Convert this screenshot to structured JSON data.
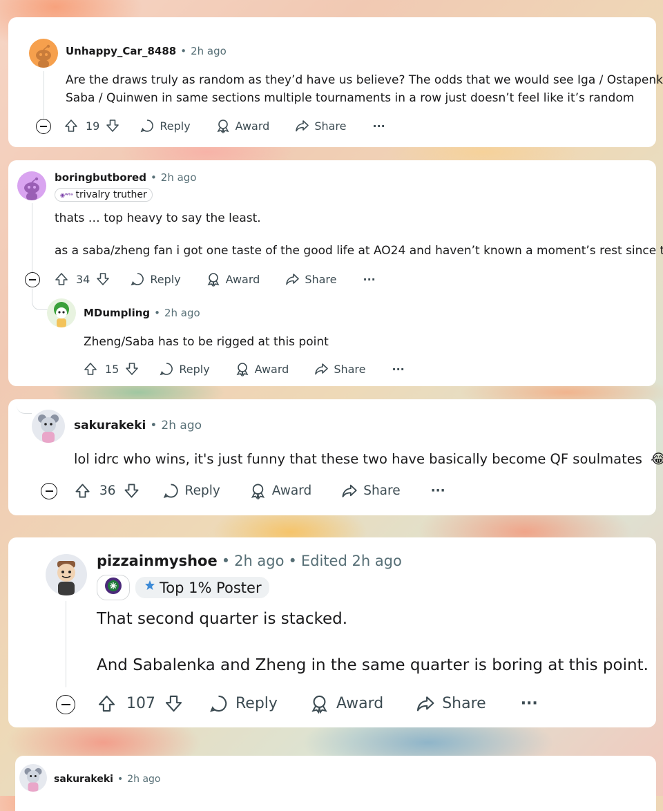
{
  "comments": [
    {
      "username": "Unhappy_Car_8488",
      "time": "2h ago",
      "lines": [
        "Are the draws truly as random as they’d have us believe? The odds that we would see Iga / Ostapenko and",
        "Saba / Quinwen in same sections multiple tournaments in a row just doesn’t feel like it’s random"
      ],
      "votes": "19",
      "reply_label": "Reply",
      "award_label": "Award",
      "share_label": "Share",
      "more_label": "···"
    },
    {
      "username": "boringbutbored",
      "time": "2h ago",
      "flair": "trivalry truther",
      "lines": [
        "thats … top heavy to say the least.",
        "as a saba/zheng fan i got one taste of the good life at AO24 and haven’t known a moment’s rest since then"
      ],
      "votes": "34",
      "reply_label": "Reply",
      "award_label": "Award",
      "share_label": "Share",
      "more_label": "···"
    },
    {
      "username": "MDumpling",
      "time": "2h ago",
      "lines": [
        "Zheng/Saba has to be rigged at this point"
      ],
      "votes": "15",
      "reply_label": "Reply",
      "award_label": "Award",
      "share_label": "Share",
      "more_label": "···"
    },
    {
      "username": "sakurakeki",
      "time": "2h ago",
      "lines": [
        "lol idrc who wins, it's just funny that these two have basically become QF soulmates"
      ],
      "emoji": "😂",
      "votes": "36",
      "reply_label": "Reply",
      "award_label": "Award",
      "share_label": "Share",
      "more_label": "···"
    },
    {
      "username": "pizzainmyshoe",
      "time": "2h ago",
      "edited": "Edited 2h ago",
      "flair": "Top 1% Poster",
      "lines": [
        "That second quarter is stacked.",
        "And Sabalenka and Zheng in the same quarter is boring at this point."
      ],
      "votes": "107",
      "reply_label": "Reply",
      "award_label": "Award",
      "share_label": "Share",
      "more_label": "···"
    },
    {
      "username": "sakurakeki",
      "time": "2h ago"
    }
  ],
  "colors": {
    "username": "#1a1a1b",
    "meta": "#576f76",
    "avatar_orange": "#f6a04d",
    "avatar_purple": "#d9a4f0"
  }
}
